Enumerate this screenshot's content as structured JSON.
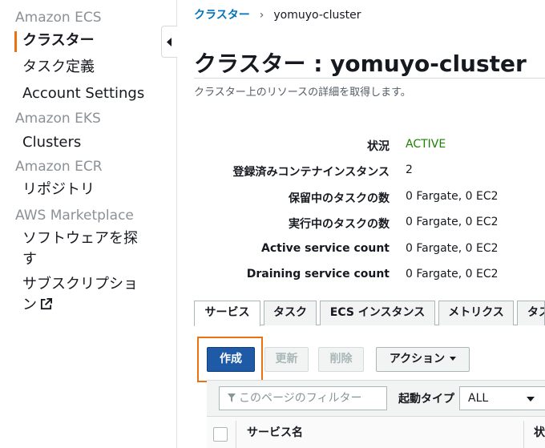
{
  "sidebar": {
    "sections": [
      {
        "title": "Amazon ECS"
      },
      {
        "title": "Amazon EKS"
      },
      {
        "title": "Amazon ECR"
      },
      {
        "title": "AWS Marketplace"
      }
    ],
    "items": {
      "clusters_ecs": "クラスター",
      "task_definitions": "タスク定義",
      "account_settings": "Account Settings",
      "clusters_eks": "Clusters",
      "repositories": "リポジトリ",
      "find_software_1": "ソフトウェアを探",
      "find_software_2": "す",
      "subscriptions_1": "サブスクリプショ",
      "subscriptions_2": "ン"
    }
  },
  "breadcrumb": {
    "parent": "クラスター",
    "separator": "›",
    "current": "yomuyo-cluster"
  },
  "page": {
    "title": "クラスター : yomuyo-cluster",
    "description": "クラスター上のリソースの詳細を取得します。"
  },
  "details": [
    {
      "label": "状況",
      "value": "ACTIVE"
    },
    {
      "label": "登録済みコンテナインスタンス",
      "value": "2"
    },
    {
      "label": "保留中のタスクの数",
      "value": "0 Fargate, 0 EC2"
    },
    {
      "label": "実行中のタスクの数",
      "value": "0 Fargate, 0 EC2"
    },
    {
      "label": "Active service count",
      "value": "0 Fargate, 0 EC2"
    },
    {
      "label": "Draining service count",
      "value": "0 Fargate, 0 EC2"
    }
  ],
  "tabs": [
    "サービス",
    "タスク",
    "ECS インスタンス",
    "メトリクス",
    "タス"
  ],
  "actions": {
    "create": "作成",
    "update": "更新",
    "delete": "削除",
    "actions": "アクション"
  },
  "filter": {
    "placeholder": "このページのフィルター",
    "launch_type_label": "起動タイプ",
    "launch_type_value": "ALL"
  },
  "table": {
    "columns": [
      "サービス名",
      "状"
    ]
  },
  "colors": {
    "accent": "#ec7211",
    "primary_button": "#1f5aa6",
    "link": "#0073bb",
    "status_active": "#1d8102"
  }
}
